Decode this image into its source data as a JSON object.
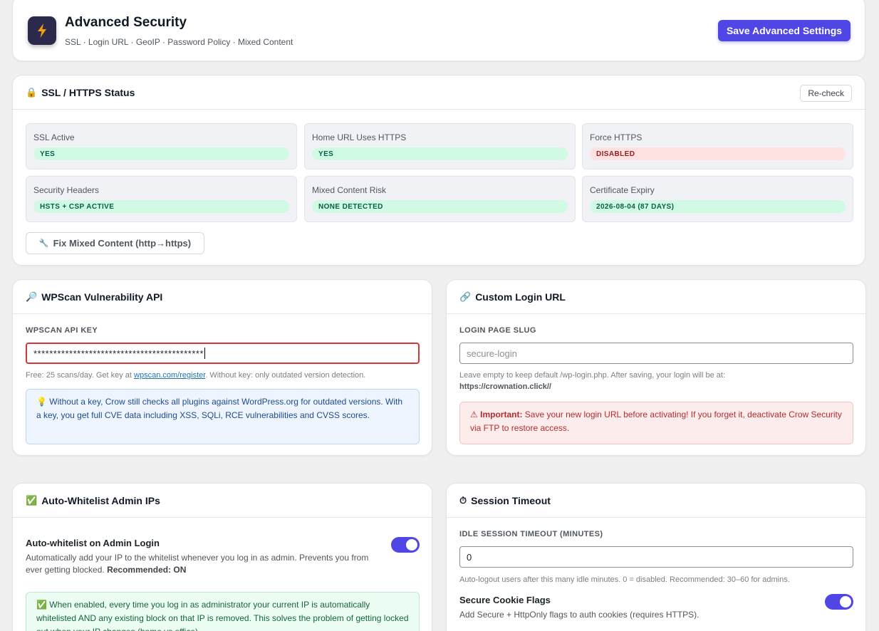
{
  "header": {
    "title": "Advanced Security",
    "subtitle": "SSL · Login URL · GeoIP · Password Policy · Mixed Content",
    "save_label": "Save Advanced Settings"
  },
  "colors": {
    "accent": "#4f46e5",
    "ok_bg": "#d1fae5",
    "ok_text": "#065f46",
    "bad_bg": "#fee2e2",
    "bad_text": "#991b1b"
  },
  "ssl": {
    "title": "SSL / HTTPS Status",
    "recheck_label": "Re-check",
    "tiles": [
      {
        "label": "SSL Active",
        "badge": "YES",
        "status": "ok"
      },
      {
        "label": "Home URL Uses HTTPS",
        "badge": "YES",
        "status": "ok"
      },
      {
        "label": "Force HTTPS",
        "badge": "DISABLED",
        "status": "bad"
      },
      {
        "label": "Security Headers",
        "badge": "HSTS + CSP ACTIVE",
        "status": "ok"
      },
      {
        "label": "Mixed Content Risk",
        "badge": "NONE DETECTED",
        "status": "ok"
      },
      {
        "label": "Certificate Expiry",
        "badge": "2026-08-04 (87 DAYS)",
        "status": "ok"
      }
    ],
    "fix_label": "Fix Mixed Content (http→https)"
  },
  "wpscan": {
    "title": "WPScan Vulnerability API",
    "field_label": "WPSCAN API KEY",
    "value": "*******************************************",
    "help_prefix": "Free: 25 scans/day. Get key at ",
    "help_link": "wpscan.com/register",
    "help_suffix": ". Without key: only outdated version detection.",
    "info": "💡 Without a key, Crow still checks all plugins against WordPress.org for outdated versions. With a key, you get full CVE data including XSS, SQLi, RCE vulnerabilities and CVSS scores."
  },
  "login": {
    "title": "Custom Login URL",
    "field_label": "LOGIN PAGE SLUG",
    "placeholder": "secure-login",
    "help_line1": "Leave empty to keep default /wp-login.php. After saving, your login will be at:",
    "help_url": "https://crownation.click//",
    "warn_strong": "Important:",
    "warn_text": " Save your new login URL before activating! If you forget it, deactivate Crow Security via FTP to restore access."
  },
  "whitelist": {
    "title": "Auto-Whitelist Admin IPs",
    "row_title": "Auto-whitelist on Admin Login",
    "row_desc": "Automatically add your IP to the whitelist whenever you log in as admin. Prevents you from ever getting blocked. ",
    "row_desc_strong": "Recommended: ON",
    "toggle_on": true,
    "info": "✅ When enabled, every time you log in as administrator your current IP is automatically whitelisted AND any existing block on that IP is removed. This solves the problem of getting locked out when your IP changes (home vs office)."
  },
  "session": {
    "title": "Session Timeout",
    "field_label": "IDLE SESSION TIMEOUT (MINUTES)",
    "value": "0",
    "help": "Auto-logout users after this many idle minutes. 0 = disabled. Recommended: 30–60 for admins.",
    "cookie_title": "Secure Cookie Flags",
    "cookie_desc": "Add Secure + HttpOnly flags to auth cookies (requires HTTPS).",
    "cookie_toggle_on": true
  }
}
